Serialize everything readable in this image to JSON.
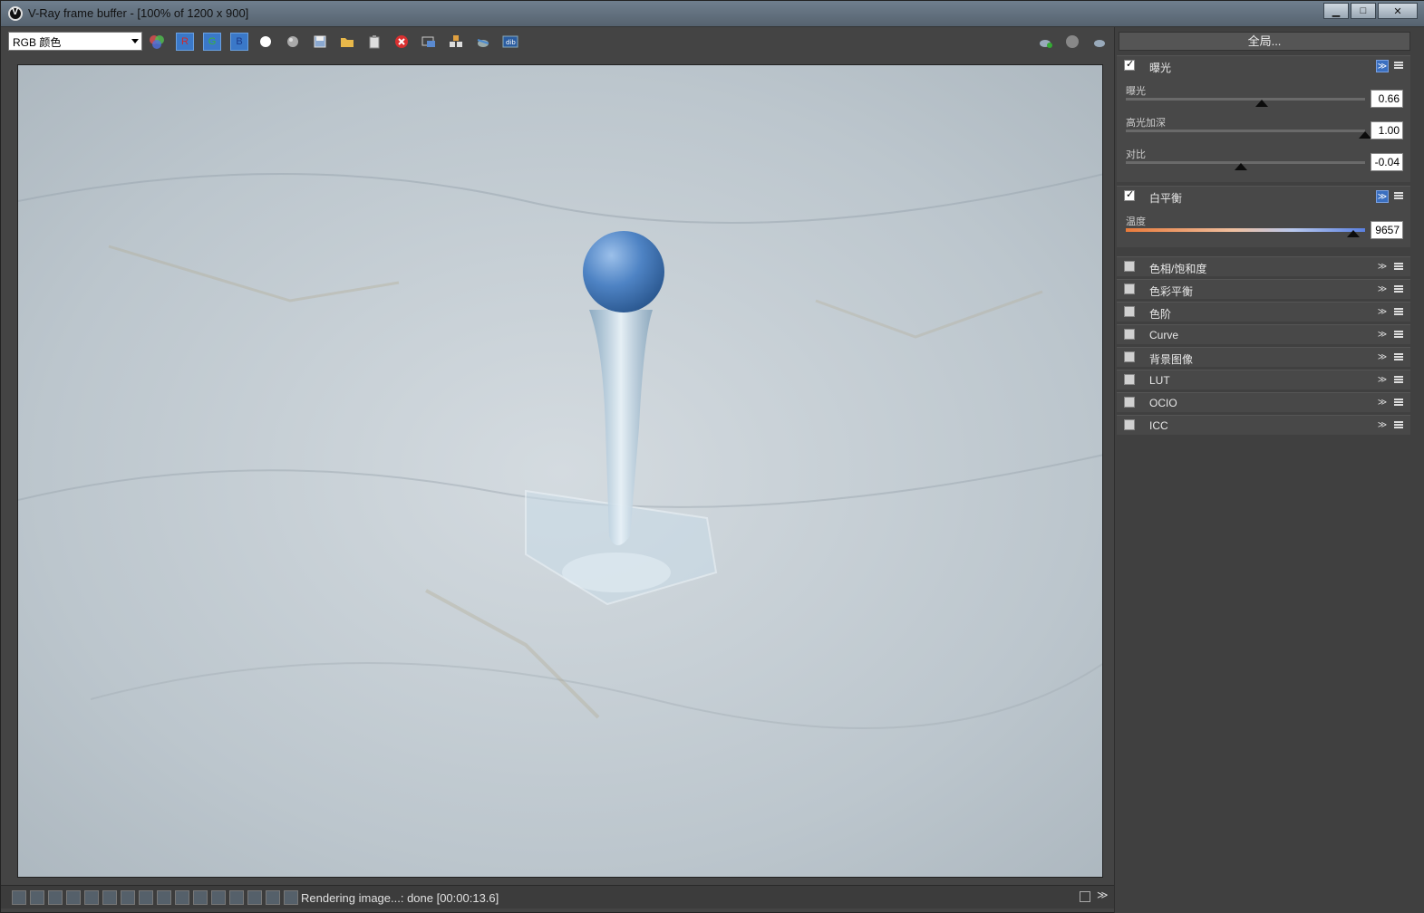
{
  "window": {
    "title": "V-Ray frame buffer - [100% of 1200 x 900]",
    "min_label": "▁",
    "max_label": "□",
    "close_label": "✕"
  },
  "toolbar": {
    "channel_select": "RGB 颜色",
    "r_label": "R",
    "g_label": "G",
    "b_label": "B"
  },
  "status": {
    "text": "Rendering image...: done [00:00:13.6]"
  },
  "panel": {
    "global_button": "全局...",
    "exposure": {
      "title": "曝光",
      "checked": true,
      "sliders": [
        {
          "label": "曝光",
          "value": "0.66",
          "position": 0.57
        },
        {
          "label": "高光加深",
          "value": "1.00",
          "position": 1.0
        },
        {
          "label": "对比",
          "value": "-0.04",
          "position": 0.48
        }
      ]
    },
    "white_balance": {
      "title": "白平衡",
      "checked": true,
      "slider": {
        "label": "温度",
        "value": "9657",
        "position": 0.95
      }
    },
    "collapsed": [
      {
        "title": "色相/饱和度"
      },
      {
        "title": "色彩平衡"
      },
      {
        "title": "色阶"
      },
      {
        "title": "Curve"
      },
      {
        "title": "背景图像"
      },
      {
        "title": "LUT"
      },
      {
        "title": "OCIO"
      },
      {
        "title": "ICC"
      }
    ],
    "expand_glyph": "≫"
  }
}
